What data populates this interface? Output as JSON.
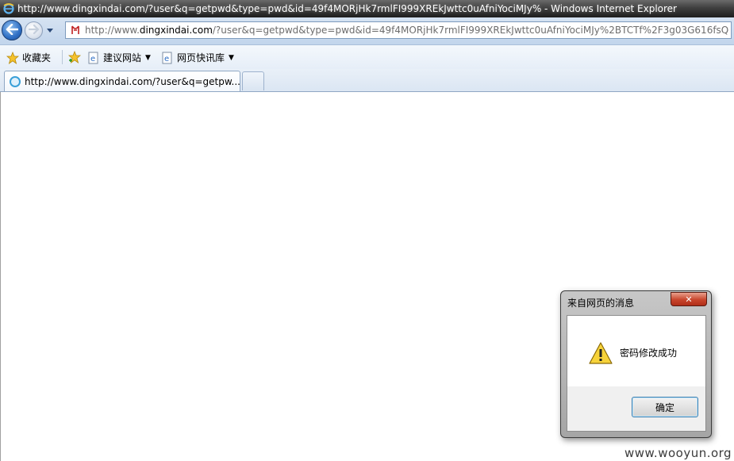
{
  "window": {
    "title": "http://www.dingxindai.com/?user&q=getpwd&type=pwd&id=49f4MORjHk7rmlFI999XREkJwttc0uAfniYociMJy% - Windows Internet Explorer"
  },
  "address_bar": {
    "url_prefix": "http://www.",
    "url_domain": "dingxindai.com",
    "url_rest": "/?user&q=getpwd&type=pwd&id=49f4MORjHk7rmlFI999XREkJwttc0uAfniYociMJy%2BTCTf%2F3g03G616fsQ"
  },
  "favorites_bar": {
    "favorites_label": "收藏夹",
    "suggested_sites_label": "建议网站",
    "web_slice_label": "网页快讯库"
  },
  "tabs": [
    {
      "label": "http://www.dingxindai.com/?user&q=getpw..."
    }
  ],
  "dialog": {
    "title": "来自网页的消息",
    "message": "密码修改成功",
    "ok_label": "确定",
    "close_glyph": "✕"
  },
  "watermark": "www.wooyun.org",
  "colors": {
    "titlebar": "#2a2a2a",
    "toolbar": "#c9daee",
    "accent": "#2f6fc4",
    "close_button": "#c8452c"
  }
}
